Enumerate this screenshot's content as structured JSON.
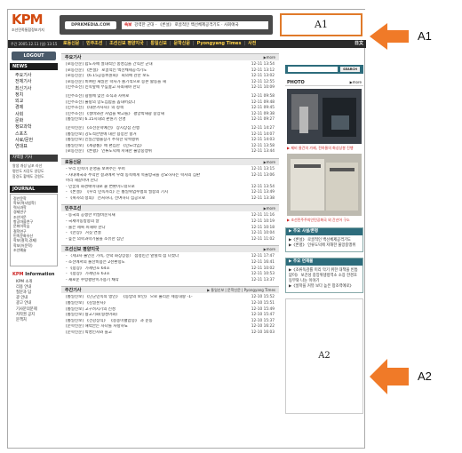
{
  "header": {
    "logo": "KPM",
    "logo_sub": "조선민족통합정보기지",
    "site_label": "DPRKMEDIA.COM",
    "ticker_hot": "속보",
    "ticker_text": "강력한 군대 - 《론설》 로골적인 백선체제공격기도 · 사회애국",
    "banner_a1": "A1"
  },
  "nav": {
    "date": "주간 2005.12.11 (일) 13:15",
    "items": [
      "로동신문",
      "민주조선",
      "조선신보 평양지국",
      "통일신보",
      "문학신문",
      "Pyongyang Times",
      "사전"
    ],
    "english": "日文"
  },
  "left": {
    "logout": "LOGOUT",
    "news_title": "NEWS",
    "news_items": [
      "주요기사",
      "전체기사",
      "최신기사",
      "정치",
      "외교",
      "경제",
      "사회",
      "문화",
      "정보과학",
      "스포츠",
      "사료/문헌",
      "연대표"
    ],
    "section_title": "자백형 기사",
    "section_lines": [
      "왕생 개성 남포 라선",
      "평안도 자강도 양강도",
      "함경도 황해도 강원도"
    ],
    "journal_title": "JOURNAL",
    "journal_items": [
      "정년문학",
      "학보(력사법학)",
      "력사과학",
      "경제연구",
      "조선어문",
      "항공마을연구",
      "문화어학습",
      "철학연구",
      "민족문화유산",
      "학보(철학,경제)",
      "학보(어문학)",
      "조선예술"
    ],
    "info_title_a": "KPM",
    "info_title_b": " Information",
    "info_items": [
      "KPM 소개",
      "리용 안내",
      "질문과 답",
      "광 안내",
      "광고 안내",
      "기사문의문제",
      "저작권 공지",
      "문책처"
    ]
  },
  "center": {
    "block1": {
      "title": "주요기사",
      "more": "▶more",
      "rows": [
        [
          "[로동신문] 랍도자매 절대적인 충성심을 간직한 군대",
          "12-11 13:54"
        ],
        [
          "[로동신문] 《론설》 로골적인 백선체제공격기도",
          "12-11 13:12"
        ],
        [
          "[로동신문] 《6.15공동위원회》 회의에 관한 보도",
          "12-11 13:02"
        ],
        [
          "[로동신문] 비여련 재일한 학사가 졸기적으로 증본 활동을 해",
          "12-11 12:55"
        ],
        [
          "[민주조선] 민족앞에 무릎꿇고 사죄해야 한다",
          "12-11 10:09"
        ]
      ],
      "rows2": [
        [
          "[민주조선] 광철에 맞선 조직과 자위로",
          "12-11 09:58"
        ],
        [
          "[민주조선] 불량의 망도집합을 뽑내어갔다",
          "12-11 09:48"
        ],
        [
          "[민주조선] 《대본거사자》의 정책",
          "12-11 09:45"
        ],
        [
          "[민주조선] 《설비와관 사업을 확고를》 평양박재광 중앙재",
          "12-11 09:38"
        ],
        [
          "[통일신보] 6.15시대의 판원기 선명",
          "12-11 09:27"
        ]
      ],
      "rows3": [
        [
          "[문학신문] 《조선문학예전》 상시상삼 진행",
          "12-11 14:27"
        ],
        [
          "[통일신보] 강도적한텐에 대한 용망한 항거",
          "12-11 14:07"
        ],
        [
          "[통일신보] 인일간행물장기 추적한 악쩍행위",
          "12-11 14:03"
        ],
        [
          "[통일신보] 《세광통》에 편집한 《민노라임》",
          "12-11 13:58"
        ],
        [
          "[로동신문] 《론평》 인류도덕에 저해한 불망중맹위",
          "12-11 13:44"
        ]
      ]
    },
    "block2": {
      "title": "로동신문",
      "more": "▶more",
      "rows": [
        [
          "- 우리 민족이 운명을 보여주는 수퍼",
          "12-11 13:15"
        ],
        [
          "- 사대매국과 추악한 결과에서 우래 동족에게 목울방국을 강요하자는 혁사의 심판",
          "12-11 13:06"
        ],
        [
          "  어리 해갈아야 한다",
          ""
        ],
        [
          "- 민꿈의 화경매이대로 붙 변환이드밖으로",
          "12-11 13:54"
        ],
        [
          "- 《론설》 《우리 민족끼리》는 통일위업수행의 필승의 기치",
          "12-11 13:49"
        ],
        [
          "- 《복자의 정의》 선처하니, 선여하니 집공으로",
          "12-11 13:38"
        ]
      ]
    },
    "block3": {
      "title": "민주조선",
      "more": "▶more",
      "rows": [
        [
          "- 동국의 공쟁한 어질비문지새",
          "12-11 11:16"
        ],
        [
          "- 국제마동방송의 날",
          "12-11 10:19"
        ],
        [
          "- 물은 제복 피해야 한다",
          "12-11 10:18"
        ],
        [
          "- 《만상》 거짓 연설",
          "12-11 10:04"
        ],
        [
          "- 높은 의학과학기술을 소유한 집단",
          "12-11 11:02"
        ]
      ]
    },
    "block4": {
      "title": "조선신보 평양지국",
      "more": "▶more",
      "rows": [
        [
          "- 〈제3차 불인진 가족, 전략 화상상봉〉 첨정민간 앞렬적 첨 나섰다",
          "12-11 17:47"
        ],
        [
          "- 조선에서의 출산비용은 2천환정도",
          "12-11 16:41"
        ],
        [
          "- 《창장》 가세년호 64호",
          "12-11 10:02"
        ],
        [
          "- 《창장》 가세년호 63호",
          "12-11 10:53"
        ],
        [
          "- 새로운 수령평탄이가용기 채작",
          "12-11 13:37"
        ]
      ]
    },
    "block5": {
      "title": "주간기사",
      "links": "▶ 통일신보 | 문학신문 | Pyongyang Times",
      "rows": [
        [
          "[통일신보] 《단군민족의 맹인》 《동방의 보인》 으로 불리운 세종대왕 -1-",
          "12-10 15:52"
        ],
        [
          "[통일신보] 《김일훈사》",
          "12-10 15:51"
        ],
        [
          "[통일신보] 고구려시기의 신성",
          "12-10 15:49"
        ],
        [
          "[통일신보] 왕고기화(형성아화)",
          "12-10 15:47"
        ],
        [
          "[통일신보] 《건강상식》 《종종미혈압증》 과 운동",
          "12-10 15:37"
        ],
        [
          "[문학신문] 해력안는 자나를 사랑하뇨",
          "12-10 16:22"
        ],
        [
          "[문학신문] 박명인자와 들고",
          "12-10 16:03"
        ]
      ]
    }
  },
  "right": {
    "search_button": "SEARCH",
    "photo_title": "PHOTO",
    "photo_more": "▶more",
    "photo_caption1": "▶ 제비 물건의 가제, 전하울의 화상상봉 진행",
    "photo_caption2": "▶ 조선민주주의인민공화국 외 간신어 구소",
    "box1_title": "▶ 주요 사설/론평",
    "box1_items": [
      "▶《론설》 로골적인 백선체제공격기도",
      "▶《론평》 인류도덕에 저해한 불망중맹위"
    ],
    "box2_title": "▶ 주요 연재물",
    "box2_items": [
      "▶《조류독감를 미리 막기 위한 대책을 빈틈없이》 보건성 중앙위생방역소 소장 한경호동무와 나눈 이야기",
      "▶《살학을 커뮤 보다 높은 창조력에로》"
    ],
    "banner_a2": "A2"
  },
  "annotations": {
    "a1": "A1",
    "a2": "A2"
  },
  "colors": {
    "accent": "#e07a2a",
    "nav_text": "#ffd24a",
    "nav_bg": "#2b2b2b",
    "teal": "#2d6c7c"
  }
}
